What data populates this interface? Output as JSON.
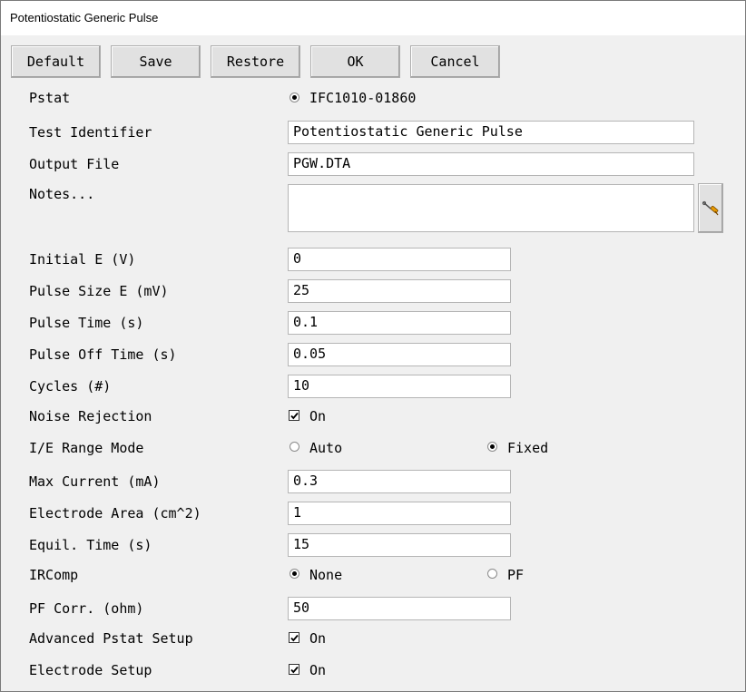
{
  "window": {
    "title": "Potentiostatic Generic Pulse"
  },
  "toolbar": {
    "default_label": "Default",
    "save_label": "Save",
    "restore_label": "Restore",
    "ok_label": "OK",
    "cancel_label": "Cancel"
  },
  "form": {
    "pstat": {
      "label": "Pstat",
      "option": "IFC1010-01860",
      "selected": true
    },
    "test_identifier": {
      "label": "Test Identifier",
      "value": "Potentiostatic Generic Pulse"
    },
    "output_file": {
      "label": "Output File",
      "value": "PGW.DTA"
    },
    "notes": {
      "label": "Notes...",
      "value": "",
      "edit_icon": "screwdriver-icon"
    },
    "initial_e": {
      "label": "Initial E (V)",
      "value": "0"
    },
    "pulse_size": {
      "label": "Pulse Size E (mV)",
      "value": "25"
    },
    "pulse_time": {
      "label": "Pulse Time (s)",
      "value": "0.1"
    },
    "pulse_off_time": {
      "label": "Pulse Off Time (s)",
      "value": "0.05"
    },
    "cycles": {
      "label": "Cycles (#)",
      "value": "10"
    },
    "noise_rejection": {
      "label": "Noise Rejection",
      "option": "On",
      "checked": true
    },
    "ie_range_mode": {
      "label": "I/E Range Mode",
      "options": [
        "Auto",
        "Fixed"
      ],
      "selected": "Fixed"
    },
    "max_current": {
      "label": "Max Current (mA)",
      "value": "0.3"
    },
    "electrode_area": {
      "label": "Electrode Area (cm^2)",
      "value": "1"
    },
    "equil_time": {
      "label": "Equil. Time (s)",
      "value": "15"
    },
    "ircomp": {
      "label": "IRComp",
      "options": [
        "None",
        "PF"
      ],
      "selected": "None"
    },
    "pf_corr": {
      "label": "PF Corr. (ohm)",
      "value": "50"
    },
    "advanced_pstat": {
      "label": "Advanced Pstat Setup",
      "option": "On",
      "checked": true
    },
    "electrode_setup": {
      "label": "Electrode Setup",
      "option": "On",
      "checked": true
    }
  }
}
